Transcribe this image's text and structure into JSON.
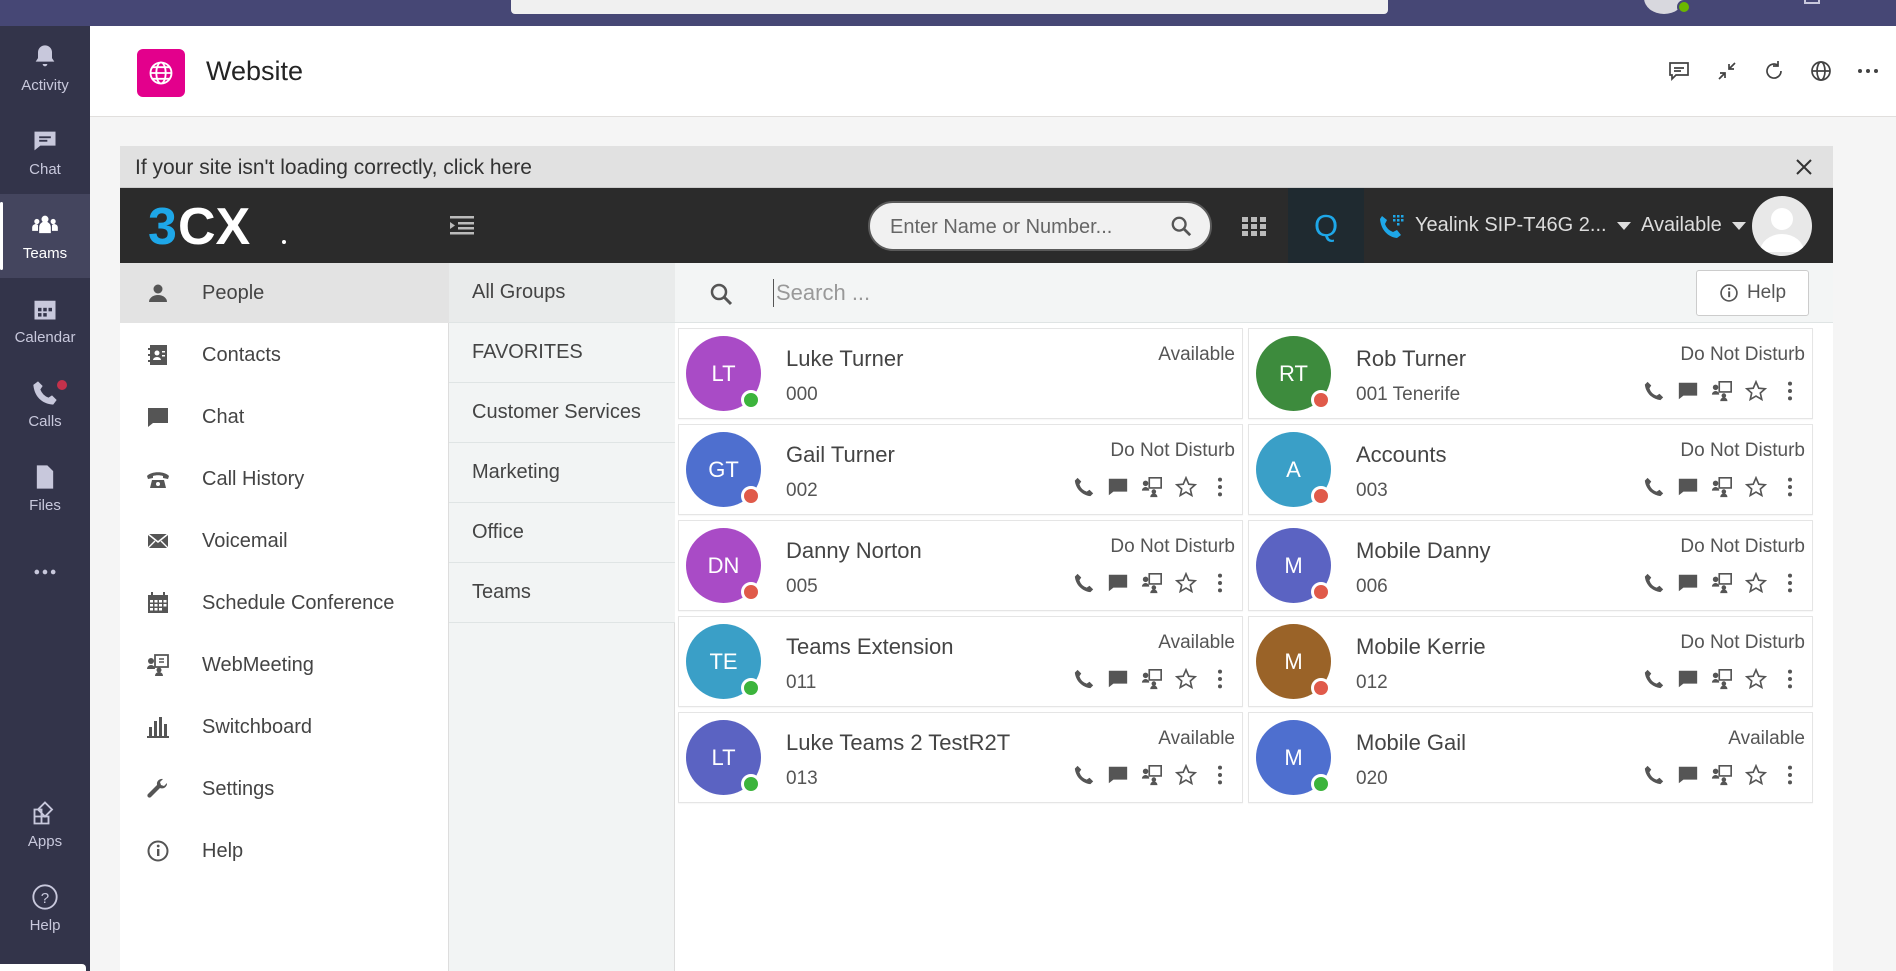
{
  "rail": {
    "items": [
      {
        "label": "Activity"
      },
      {
        "label": "Chat"
      },
      {
        "label": "Teams"
      },
      {
        "label": "Calendar"
      },
      {
        "label": "Calls"
      },
      {
        "label": "Files"
      },
      {
        "label": "Apps"
      },
      {
        "label": "Help"
      }
    ],
    "active": "Teams"
  },
  "header": {
    "title": "Website",
    "accent": "#e3008c"
  },
  "banner": {
    "text": "If your site isn't loading correctly, click here"
  },
  "cx": {
    "logo_text": "3CX",
    "search_placeholder": "Enter Name or Number...",
    "q_label": "Q",
    "phone_name": "Yealink SIP-T46G 2...",
    "status": "Available"
  },
  "nav": {
    "items": [
      {
        "label": "People",
        "active": true
      },
      {
        "label": "Contacts"
      },
      {
        "label": "Chat"
      },
      {
        "label": "Call History"
      },
      {
        "label": "Voicemail"
      },
      {
        "label": "Schedule Conference"
      },
      {
        "label": "WebMeeting"
      },
      {
        "label": "Switchboard"
      },
      {
        "label": "Settings"
      },
      {
        "label": "Help"
      }
    ]
  },
  "groups": {
    "items": [
      {
        "label": "All Groups",
        "active": true
      },
      {
        "label": "FAVORITES"
      },
      {
        "label": "Customer Services"
      },
      {
        "label": "Marketing"
      },
      {
        "label": "Office"
      },
      {
        "label": "Teams"
      }
    ]
  },
  "main": {
    "search_placeholder": "Search ...",
    "help_label": "Help"
  },
  "colors": {
    "available": "#3cb43c",
    "dnd": "#e05a4a"
  },
  "people": [
    {
      "initials": "LT",
      "name": "Luke Turner",
      "ext": "000",
      "status": "Available",
      "color": "#a94bc6",
      "presence": "available",
      "actions": false
    },
    {
      "initials": "RT",
      "name": "Rob Turner",
      "ext": "001  Tenerife",
      "status": "Do Not Disturb",
      "color": "#3d8b3d",
      "presence": "dnd",
      "actions": true
    },
    {
      "initials": "GT",
      "name": "Gail Turner",
      "ext": "002",
      "status": "Do Not Disturb",
      "color": "#4e6fcf",
      "presence": "dnd",
      "actions": true
    },
    {
      "initials": "A",
      "name": "Accounts",
      "ext": "003",
      "status": "Do Not Disturb",
      "color": "#3a9fc7",
      "presence": "dnd",
      "actions": true
    },
    {
      "initials": "DN",
      "name": "Danny Norton",
      "ext": "005",
      "status": "Do Not Disturb",
      "color": "#a94bc6",
      "presence": "dnd",
      "actions": true
    },
    {
      "initials": "M",
      "name": "Mobile Danny",
      "ext": "006",
      "status": "Do Not Disturb",
      "color": "#5b63c2",
      "presence": "dnd",
      "actions": true
    },
    {
      "initials": "TE",
      "name": "Teams Extension",
      "ext": "011",
      "status": "Available",
      "color": "#3a9fc7",
      "presence": "available",
      "actions": true
    },
    {
      "initials": "M",
      "name": "Mobile Kerrie",
      "ext": "012",
      "status": "Do Not Disturb",
      "color": "#9a6328",
      "presence": "dnd",
      "actions": true
    },
    {
      "initials": "LT",
      "name": "Luke Teams 2 TestR2T",
      "ext": "013",
      "status": "Available",
      "color": "#5b63c2",
      "presence": "available",
      "actions": true
    },
    {
      "initials": "M",
      "name": "Mobile Gail",
      "ext": "020",
      "status": "Available",
      "color": "#4e6fcf",
      "presence": "available",
      "actions": true
    }
  ]
}
